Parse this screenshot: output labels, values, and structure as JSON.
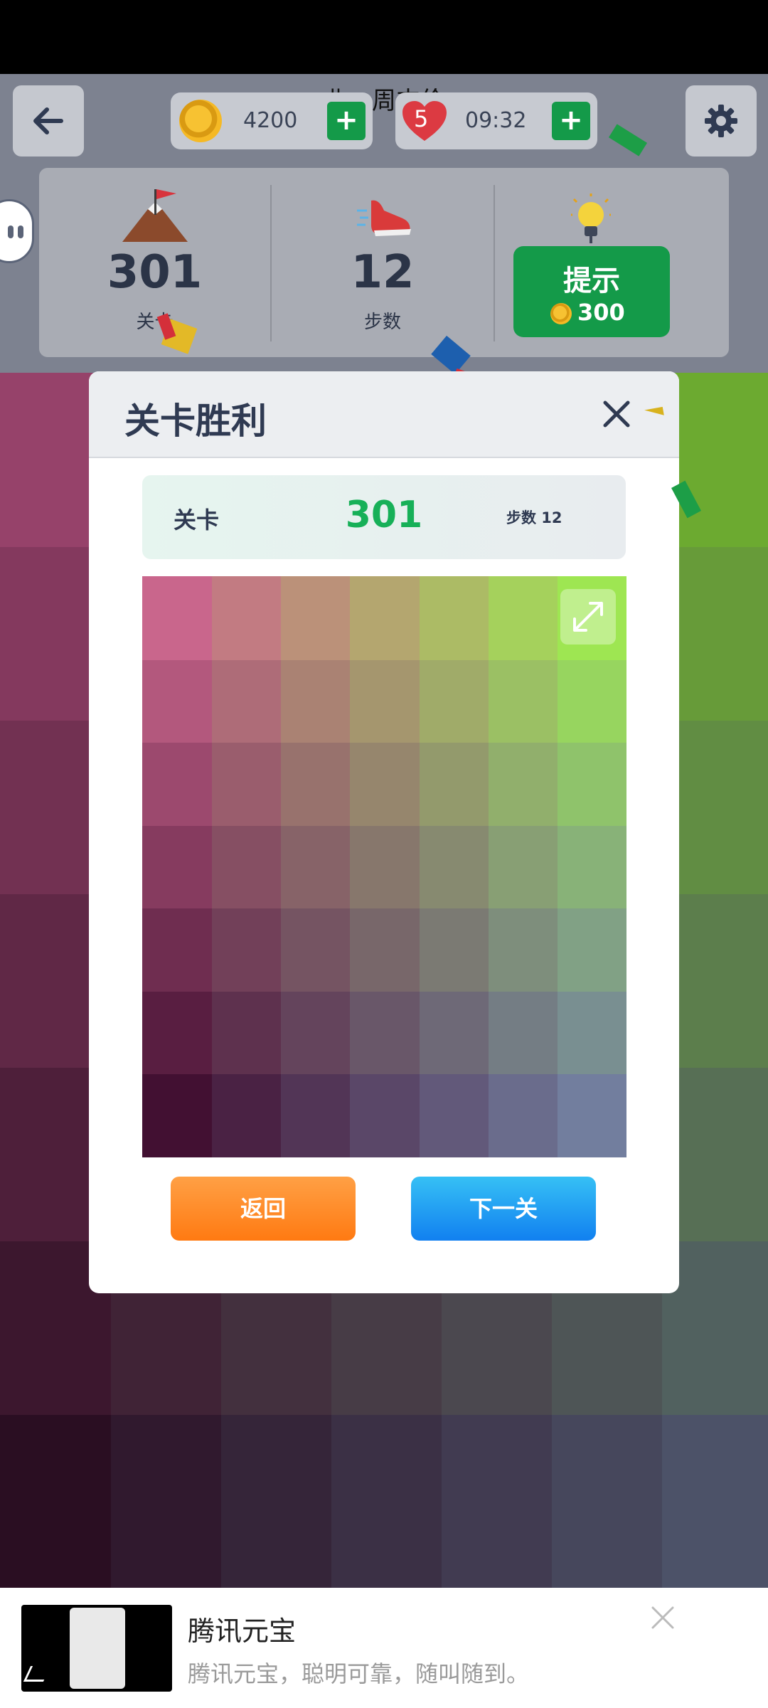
{
  "top": {
    "song": "曲：周杰伦",
    "coins": "4200",
    "lives": "5",
    "timer": "09:32"
  },
  "stats": {
    "level_value": "301",
    "level_label": "关卡",
    "steps_value": "12",
    "steps_label": "步数",
    "hint_label": "提示",
    "hint_cost": "300"
  },
  "modal": {
    "title": "关卡胜利",
    "level_label": "关卡",
    "level_value": "301",
    "steps_text": "步数 12",
    "back_label": "返回",
    "next_label": "下一关"
  },
  "ad": {
    "title": "腾讯元宝",
    "subtitle": "腾讯元宝，聪明可靠，随叫随到。"
  },
  "colors": {
    "green": "#149a49",
    "orange": "#ff8a24",
    "blue": "#1a96f2",
    "level_green": "#17b058"
  }
}
